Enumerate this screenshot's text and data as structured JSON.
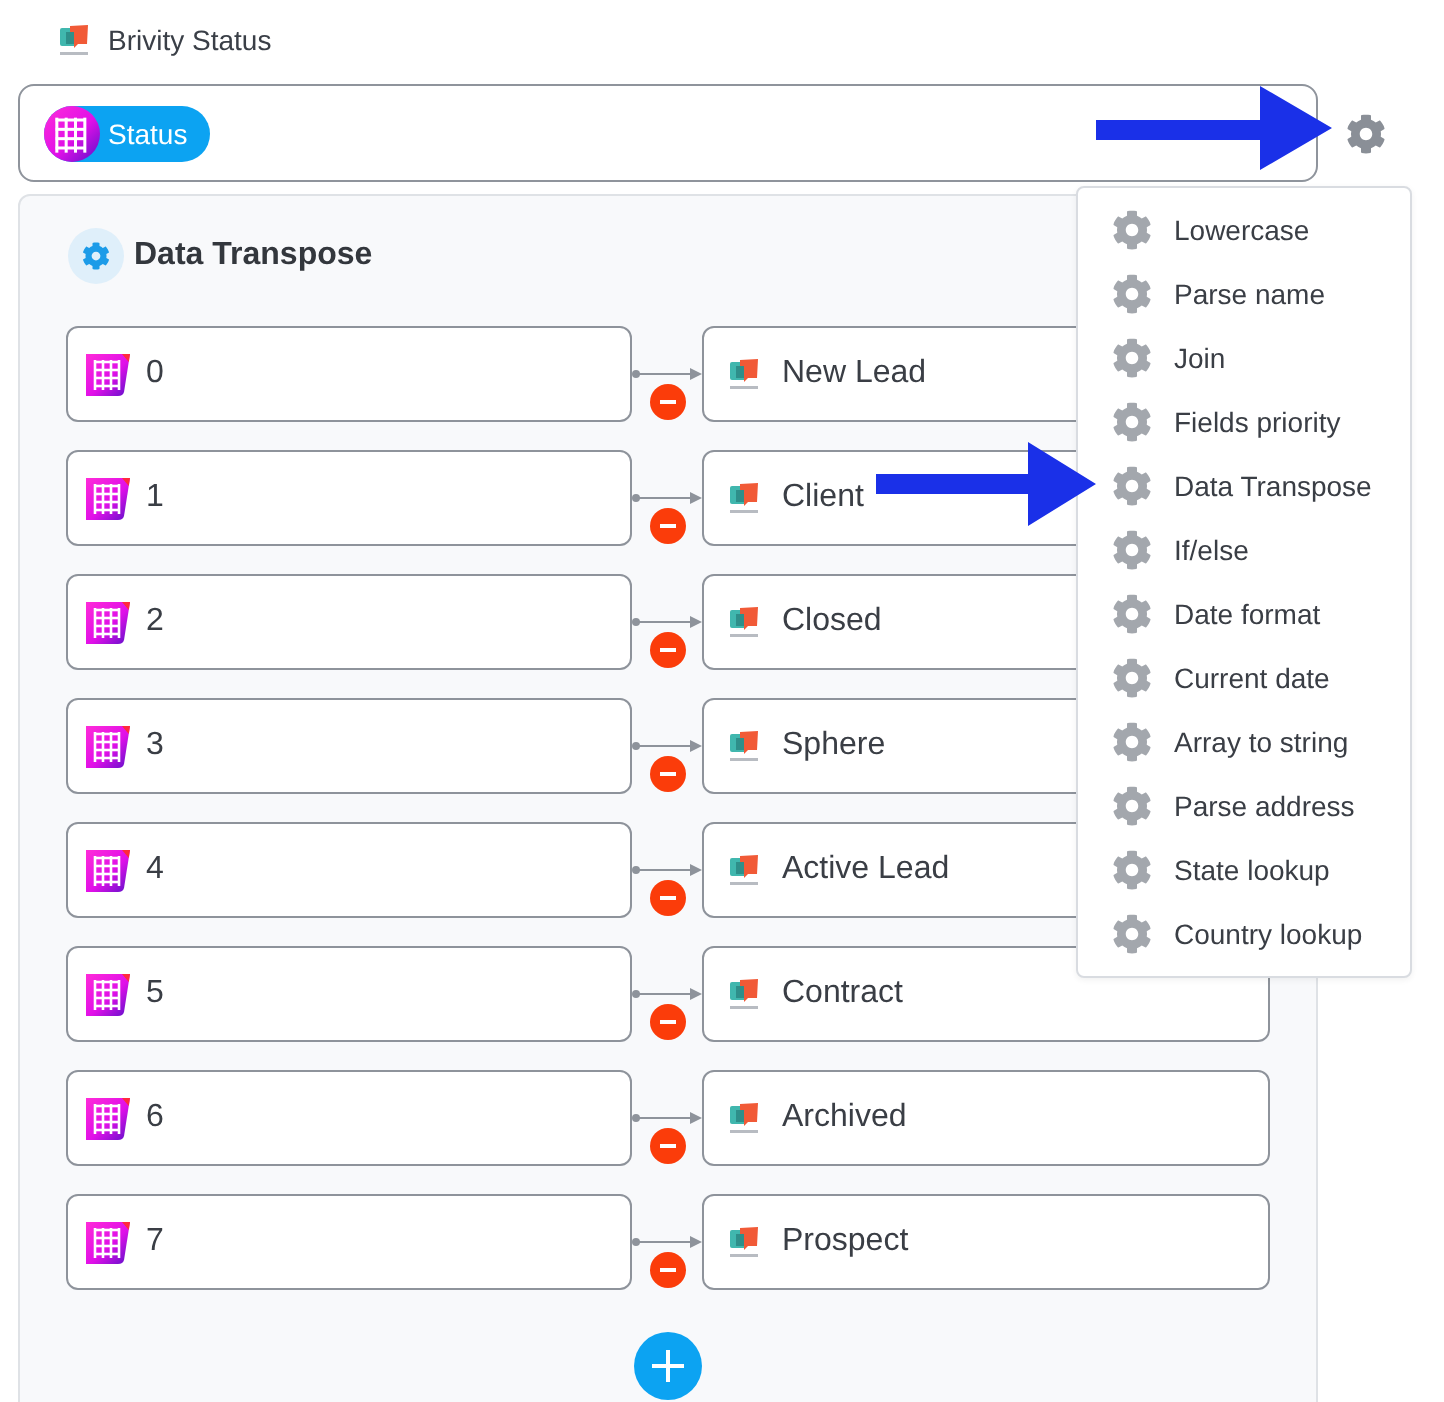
{
  "header": {
    "title": "Brivity Status"
  },
  "field": {
    "chips": [
      {
        "label": "Status"
      }
    ]
  },
  "transform": {
    "title": "Data Transpose",
    "mappings": [
      {
        "source": "0",
        "target": "New Lead"
      },
      {
        "source": "1",
        "target": "Client"
      },
      {
        "source": "2",
        "target": "Closed"
      },
      {
        "source": "3",
        "target": "Sphere"
      },
      {
        "source": "4",
        "target": "Active Lead"
      },
      {
        "source": "5",
        "target": "Contract"
      },
      {
        "source": "6",
        "target": "Archived"
      },
      {
        "source": "7",
        "target": "Prospect"
      }
    ]
  },
  "menu": {
    "items": [
      {
        "label": "Lowercase"
      },
      {
        "label": "Parse name"
      },
      {
        "label": "Join"
      },
      {
        "label": "Fields priority"
      },
      {
        "label": "Data Transpose"
      },
      {
        "label": "If/else"
      },
      {
        "label": "Date format"
      },
      {
        "label": "Current date"
      },
      {
        "label": "Array to string"
      },
      {
        "label": "Parse address"
      },
      {
        "label": "State lookup"
      },
      {
        "label": "Country lookup"
      }
    ]
  }
}
